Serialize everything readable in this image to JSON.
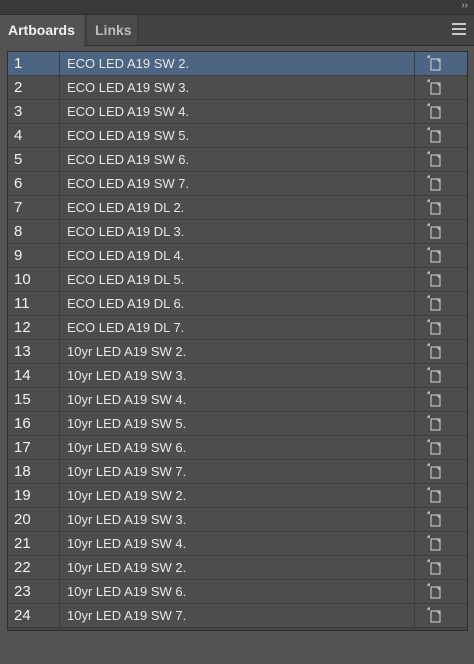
{
  "header": {
    "collapse_glyph": "››",
    "tabs": [
      {
        "label": "Artboards",
        "active": true
      },
      {
        "label": "Links",
        "active": false
      }
    ],
    "menu_icon": "hamburger-menu-icon"
  },
  "colors": {
    "panel_bg": "#535353",
    "row_bg": "#4d4d4d",
    "selected_row_bg": "#4b6582",
    "text": "#e6e6e6"
  },
  "artboards": [
    {
      "num": "1",
      "name": "ECO LED A19 SW 2.",
      "selected": true
    },
    {
      "num": "2",
      "name": "ECO LED A19 SW 3."
    },
    {
      "num": "3",
      "name": "ECO LED A19 SW 4."
    },
    {
      "num": "4",
      "name": "ECO LED A19 SW 5."
    },
    {
      "num": "5",
      "name": "ECO LED A19 SW 6."
    },
    {
      "num": "6",
      "name": "ECO LED A19 SW 7."
    },
    {
      "num": "7",
      "name": "ECO LED A19 DL 2."
    },
    {
      "num": "8",
      "name": "ECO LED A19 DL 3."
    },
    {
      "num": "9",
      "name": "ECO LED A19 DL 4."
    },
    {
      "num": "10",
      "name": "ECO LED A19 DL 5."
    },
    {
      "num": "11",
      "name": "ECO LED A19 DL 6."
    },
    {
      "num": "12",
      "name": "ECO LED A19 DL 7."
    },
    {
      "num": "13",
      "name": "10yr LED A19 SW 2."
    },
    {
      "num": "14",
      "name": "10yr LED A19 SW 3."
    },
    {
      "num": "15",
      "name": "10yr LED A19 SW 4."
    },
    {
      "num": "16",
      "name": "10yr LED A19 SW 5."
    },
    {
      "num": "17",
      "name": "10yr LED A19 SW 6."
    },
    {
      "num": "18",
      "name": "10yr LED A19 SW 7."
    },
    {
      "num": "19",
      "name": "10yr LED A19 SW 2."
    },
    {
      "num": "20",
      "name": "10yr LED A19 SW 3."
    },
    {
      "num": "21",
      "name": "10yr LED A19 SW 4."
    },
    {
      "num": "22",
      "name": "10yr LED A19 SW 2."
    },
    {
      "num": "23",
      "name": "10yr LED A19 SW 6."
    },
    {
      "num": "24",
      "name": "10yr LED A19 SW 7."
    }
  ],
  "row_icon": "artboard-options-icon"
}
